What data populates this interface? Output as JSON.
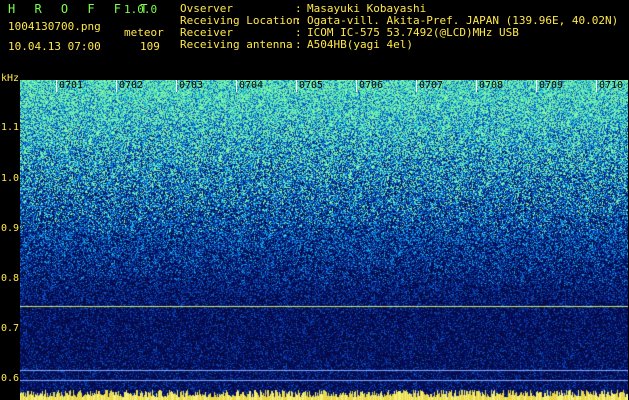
{
  "header": {
    "app_title": "H R O F F T",
    "app_version": "1.0.0",
    "file_name": "1004130700.png",
    "meteor_label": "meteor",
    "date_time": "10.04.13 07:00",
    "meteor_count": "109"
  },
  "info": [
    {
      "key": "Ovserver",
      "sep": ":",
      "value": "Masayuki Kobayashi"
    },
    {
      "key": "Receiving Location",
      "sep": ":",
      "value": "Ogata-vill. Akita-Pref. JAPAN (139.96E, 40.02N)"
    },
    {
      "key": "Receiver",
      "sep": ":",
      "value": "ICOM IC-575 53.7492(@LCD)MHz USB"
    },
    {
      "key": "Receiving antenna",
      "sep": ":",
      "value": "A504HB(yagi 4el)"
    }
  ],
  "yaxis": {
    "unit": "kHz",
    "ticks": [
      "1.1",
      "1.0",
      "0.9",
      "0.8",
      "0.7",
      "0.6"
    ]
  },
  "xaxis": {
    "ticks": [
      "0701",
      "0702",
      "0703",
      "0704",
      "0705",
      "0706",
      "0707",
      "0708",
      "0709",
      "0710"
    ]
  },
  "colors": {
    "accent_green": "#7CFF4A",
    "accent_yellow": "#FFE84A",
    "background": "#000000"
  }
}
